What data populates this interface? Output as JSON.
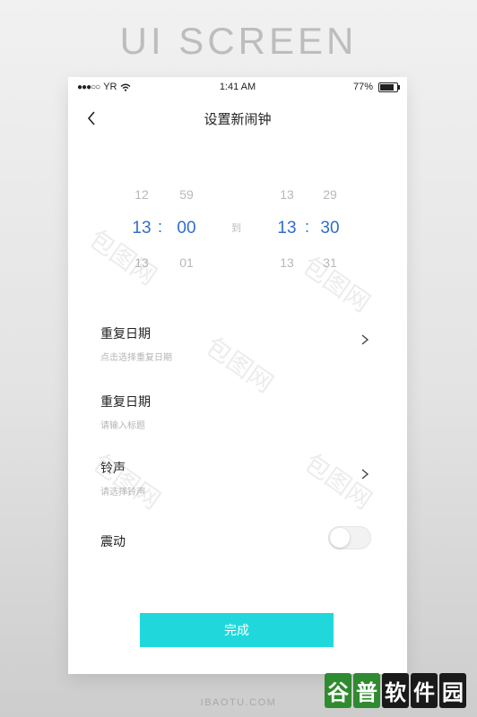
{
  "headline": "UI SCREEN",
  "status_bar": {
    "carrier": "YR",
    "signal_dots": "●●●○○",
    "time": "1:41 AM",
    "battery": "77%"
  },
  "nav": {
    "title": "设置新闹钟",
    "back_icon": "chevron-left-icon"
  },
  "picker": {
    "start_hour": {
      "prev": "12",
      "selected": "13",
      "next": "13"
    },
    "start_minute": {
      "prev": "59",
      "selected": "00",
      "next": "01"
    },
    "separator": ":",
    "to_label": "到",
    "end_hour": {
      "prev": "13",
      "selected": "13",
      "next": "13"
    },
    "end_minute": {
      "prev": "29",
      "selected": "30",
      "next": "31"
    }
  },
  "settings": [
    {
      "label": "重复日期",
      "sub": "点击选择重复日期"
    },
    {
      "label": "重复日期",
      "sub": "请输入标题"
    },
    {
      "label": "铃声",
      "sub": "请选择铃声"
    },
    {
      "label": "震动"
    }
  ],
  "vibrate_on": false,
  "done_button": "完成",
  "footer": "IBAOTU.COM",
  "watermark": "包图网",
  "brand": [
    "谷",
    "普",
    "软",
    "件",
    "园"
  ],
  "colors": {
    "accent": "#2f6ec9",
    "button": "#20d8dc"
  }
}
